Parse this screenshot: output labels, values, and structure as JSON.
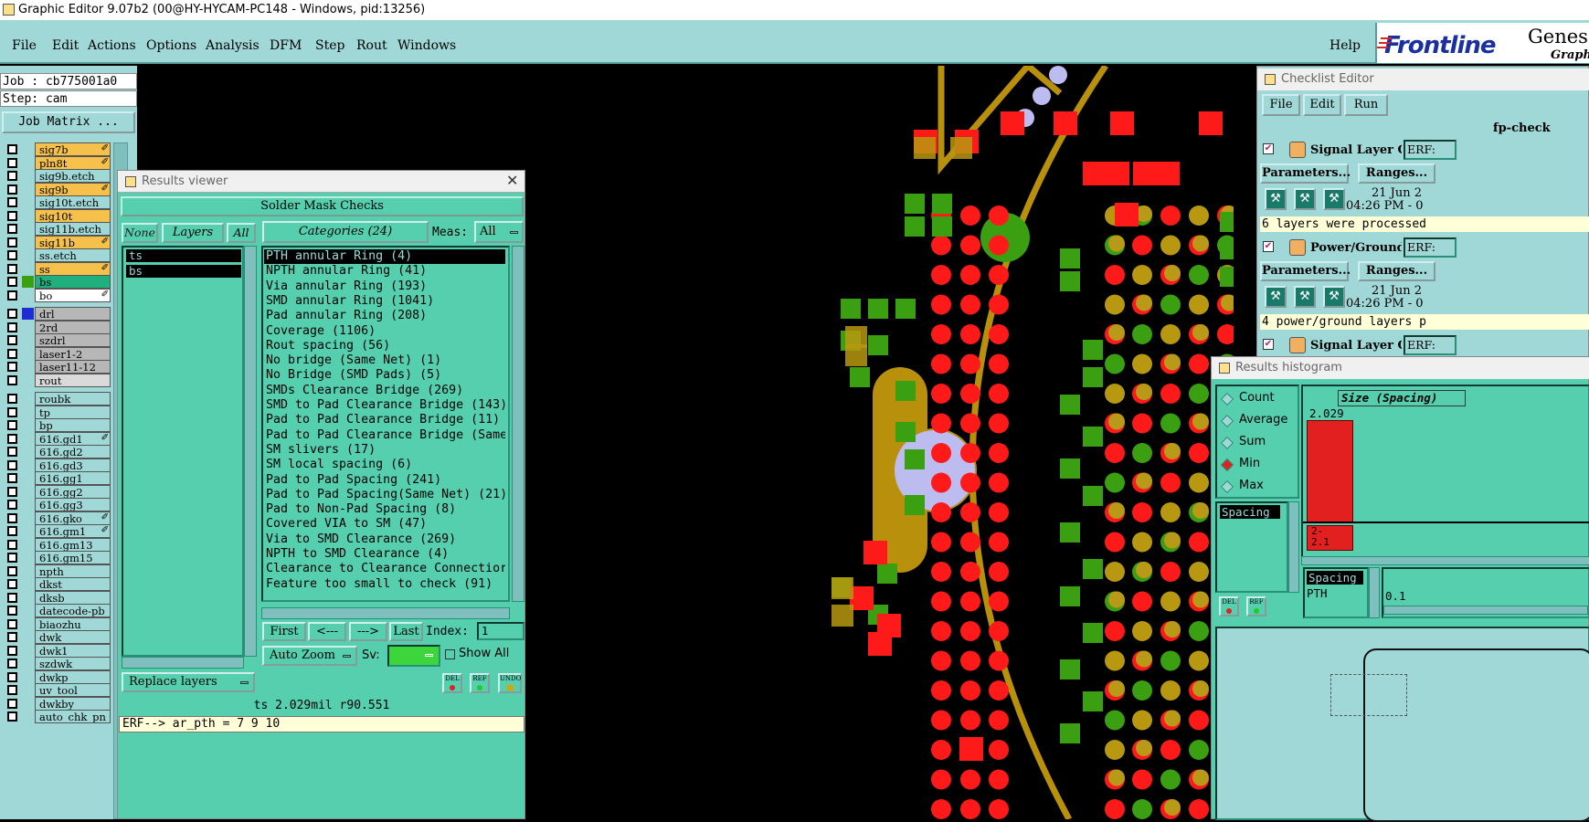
{
  "window_title": "Graphic Editor 9.07b2 (00@HY-HYCAM-PC148 - Windows, pid:13256)",
  "menu": [
    "File",
    "Edit",
    "Actions",
    "Options",
    "Analysis",
    "DFM",
    "Step",
    "Rout",
    "Windows"
  ],
  "help": "Help",
  "logo": {
    "brand": "Frontline",
    "product": "Genes",
    "sub": "Graphi"
  },
  "job": {
    "job_label": "Job : cb775001a0",
    "step_label": "Step: cam",
    "matrix_button": "Job Matrix ..."
  },
  "layers": [
    {
      "name": "sig7b",
      "color": "#f5c14a",
      "mark": "✐"
    },
    {
      "name": "pln8t",
      "color": "#f5c14a",
      "mark": "✐"
    },
    {
      "name": "sig9b.etch",
      "color": "#9fd8d6",
      "mark": ""
    },
    {
      "name": "sig9b",
      "color": "#f5c14a",
      "mark": "✐"
    },
    {
      "name": "sig10t.etch",
      "color": "#9fd8d6",
      "mark": ""
    },
    {
      "name": "sig10t",
      "color": "#f5c14a",
      "mark": ""
    },
    {
      "name": "sig11b.etch",
      "color": "#9fd8d6",
      "mark": ""
    },
    {
      "name": "sig11b",
      "color": "#f5c14a",
      "mark": "✐"
    },
    {
      "name": "ss.etch",
      "color": "#9fd8d6",
      "mark": ""
    },
    {
      "name": "ss",
      "color": "#f5c14a",
      "mark": "✐"
    },
    {
      "name": "bs",
      "color": "#1fb07e",
      "mark": ""
    },
    {
      "name": "bo",
      "color": "#ffffff",
      "mark": "✐"
    },
    {
      "name": "drl",
      "color": "#b7b7b7",
      "mark": ""
    },
    {
      "name": "2rd",
      "color": "#b7b7b7",
      "mark": ""
    },
    {
      "name": "szdrl",
      "color": "#b7b7b7",
      "mark": ""
    },
    {
      "name": "laser1-2",
      "color": "#b7b7b7",
      "mark": ""
    },
    {
      "name": "laser11-12",
      "color": "#b7b7b7",
      "mark": ""
    },
    {
      "name": "rout",
      "color": "#d9d9d9",
      "mark": ""
    },
    {
      "name": "roubk",
      "color": "#9fd8d6",
      "mark": ""
    },
    {
      "name": "tp",
      "color": "#9fd8d6",
      "mark": ""
    },
    {
      "name": "bp",
      "color": "#9fd8d6",
      "mark": ""
    },
    {
      "name": "616.gd1",
      "color": "#9fd8d6",
      "mark": "✐"
    },
    {
      "name": "616.gd2",
      "color": "#9fd8d6",
      "mark": ""
    },
    {
      "name": "616.gd3",
      "color": "#9fd8d6",
      "mark": ""
    },
    {
      "name": "616.gg1",
      "color": "#9fd8d6",
      "mark": ""
    },
    {
      "name": "616.gg2",
      "color": "#9fd8d6",
      "mark": ""
    },
    {
      "name": "616.gg3",
      "color": "#9fd8d6",
      "mark": ""
    },
    {
      "name": "616.gko",
      "color": "#9fd8d6",
      "mark": "✐"
    },
    {
      "name": "616.gm1",
      "color": "#9fd8d6",
      "mark": "✐"
    },
    {
      "name": "616.gm13",
      "color": "#9fd8d6",
      "mark": ""
    },
    {
      "name": "616.gm15",
      "color": "#9fd8d6",
      "mark": ""
    },
    {
      "name": "npth",
      "color": "#9fd8d6",
      "mark": ""
    },
    {
      "name": "dkst",
      "color": "#9fd8d6",
      "mark": ""
    },
    {
      "name": "dksb",
      "color": "#9fd8d6",
      "mark": ""
    },
    {
      "name": "datecode-pb",
      "color": "#9fd8d6",
      "mark": ""
    },
    {
      "name": "biaozhu",
      "color": "#9fd8d6",
      "mark": ""
    },
    {
      "name": "dwk",
      "color": "#9fd8d6",
      "mark": ""
    },
    {
      "name": "dwk1",
      "color": "#9fd8d6",
      "mark": ""
    },
    {
      "name": "szdwk",
      "color": "#9fd8d6",
      "mark": ""
    },
    {
      "name": "dwkp",
      "color": "#9fd8d6",
      "mark": ""
    },
    {
      "name": "uv_tool",
      "color": "#9fd8d6",
      "mark": ""
    },
    {
      "name": "dwkby",
      "color": "#9fd8d6",
      "mark": ""
    },
    {
      "name": "auto_chk_pn",
      "color": "#9fd8d6",
      "mark": ""
    }
  ],
  "results_viewer": {
    "title": "Results viewer",
    "header": "Solder Mask Checks",
    "none_btn": "None",
    "layers_btn": "Layers",
    "all_btn": "All",
    "layer_items": [
      "ts",
      "bs"
    ],
    "categories_btn": "Categories (24)",
    "meas_label": "Meas:",
    "meas_value": "All",
    "categories": [
      "PTH annular Ring (4)",
      "NPTH annular Ring (41)",
      "Via annular Ring (193)",
      "SMD annular Ring (1041)",
      "Pad annular Ring (208)",
      "Coverage (1106)",
      "Rout spacing (56)",
      "No bridge (Same Net) (1)",
      "No Bridge (SMD Pads) (5)",
      "SMDs Clearance Bridge (269)",
      "SMD to Pad Clearance Bridge (143)",
      "Pad to Pad Clearance Bridge (11)",
      "Pad to Pad Clearance Bridge (Same",
      "SM slivers (17)",
      "SM local spacing (6)",
      "Pad to Pad Spacing (241)",
      "Pad to Pad Spacing(Same Net) (21)",
      "Pad to Non-Pad Spacing (8)",
      "Covered VIA to SM (47)",
      "Via to SMD Clearance (269)",
      "NPTH to SMD Clearance (4)",
      "Clearance to Clearance Connectior",
      "Feature too small to check (91)"
    ],
    "first_btn": "First",
    "prev_btn": "<---",
    "next_btn": "--->",
    "last_btn": "Last",
    "index_label": "Index:",
    "index_value": "1",
    "replace_layers": "Replace layers",
    "auto_zoom": "Auto Zoom",
    "sv_label": "Sv:",
    "show_all": "Show All",
    "del_btn": "DEL",
    "ref_btn": "REF",
    "undo_btn": "UNDO",
    "status": "ts 2.029mil  r90.551",
    "erf": "ERF--> ar_pth = 7 9 10"
  },
  "checklist": {
    "title": "Checklist Editor",
    "menu": [
      "File",
      "Edit",
      "Run"
    ],
    "name": "fp-check",
    "items": [
      {
        "label": "Signal Layer Ch",
        "erf": "ERF:",
        "date": "21 Jun 2",
        "time": "04:26 PM - 0",
        "message": "6 layers were processed"
      },
      {
        "label": "Power/Ground C",
        "erf": "ERF:",
        "date": "21 Jun 2",
        "time": "04:26 PM - 0",
        "message": "4 power/ground layers p"
      },
      {
        "label": "Signal Layer Ch",
        "erf": "ERF:"
      }
    ],
    "params_btn": "Parameters...",
    "ranges_btn": "Ranges..."
  },
  "histogram": {
    "title": "Results histogram",
    "modes": [
      "Count",
      "Average",
      "Sum",
      "Min",
      "Max"
    ],
    "selected_mode": "Min",
    "axis_label": "Size (Spacing)",
    "max_value": "2.029",
    "bin_label": "2-\n2.1",
    "list_item": "Spacing",
    "measures": [
      "Spacing",
      "PTH"
    ],
    "scale": "0.1",
    "del_btn": "DEL",
    "ref_btn": "REF"
  }
}
